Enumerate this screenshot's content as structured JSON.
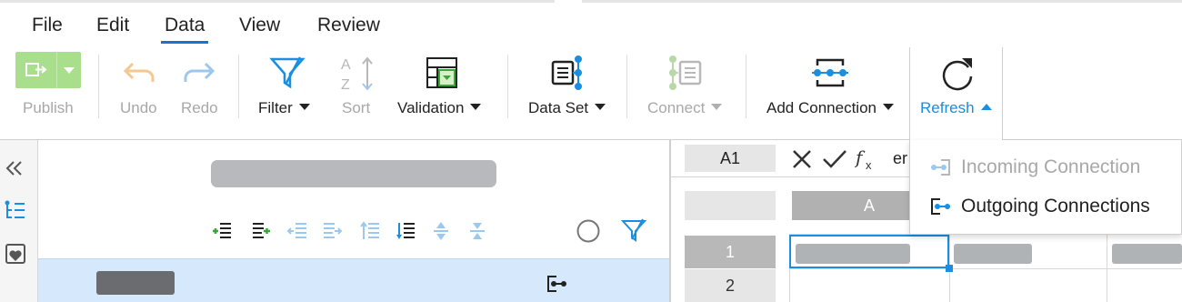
{
  "menu": {
    "file": "File",
    "edit": "Edit",
    "data": "Data",
    "view": "View",
    "review": "Review"
  },
  "ribbon": {
    "publish": "Publish",
    "undo": "Undo",
    "redo": "Redo",
    "filter": "Filter",
    "sort": "Sort",
    "validation": "Validation",
    "data_set": "Data Set",
    "connect": "Connect",
    "add_connection": "Add Connection",
    "refresh": "Refresh"
  },
  "dropdown": {
    "incoming": "Incoming Connection",
    "outgoing": "Outgoing Connections"
  },
  "sheet": {
    "name_box": "A1",
    "formula_text": "er",
    "columns": [
      "A"
    ],
    "rows": [
      "1",
      "2"
    ]
  },
  "colors": {
    "accent": "#1a8ee0",
    "publish_green": "#a8de8c",
    "row_highlight": "#d6e8fb"
  }
}
